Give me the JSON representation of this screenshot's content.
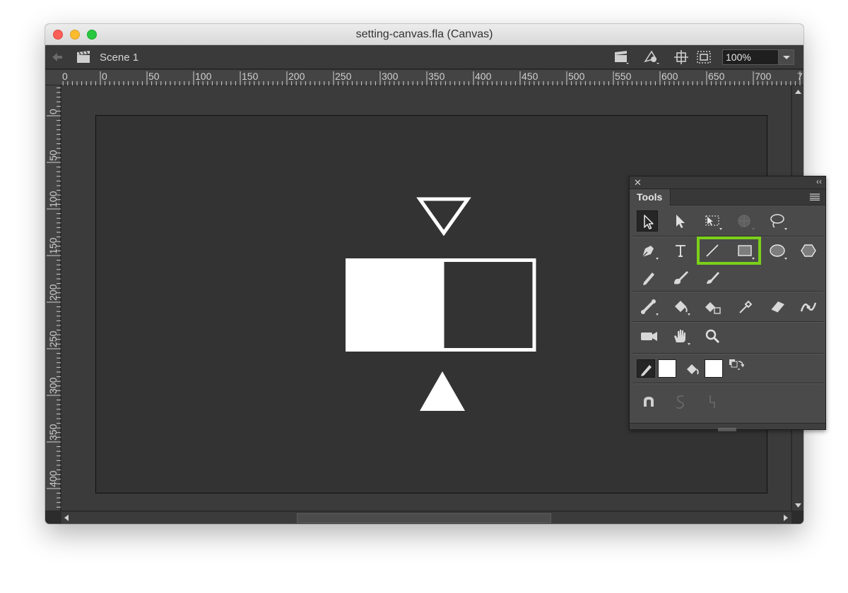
{
  "window": {
    "title": "setting-canvas.fla (Canvas)"
  },
  "appbar": {
    "scene_label": "Scene 1",
    "zoom_value": "100%",
    "icons": [
      "back-arrow-icon",
      "scene-clapper-icon",
      "edit-scene-icon",
      "edit-symbols-icon",
      "snap-center-icon",
      "clip-stage-icon"
    ]
  },
  "ruler": {
    "horizontal_labels": [
      "0",
      "0",
      "50",
      "100",
      "150",
      "200",
      "250",
      "300",
      "350",
      "400",
      "450",
      "500",
      "550",
      "600",
      "650",
      "700",
      "7"
    ],
    "vertical_labels": [
      "0",
      "50",
      "100",
      "150",
      "200",
      "250",
      "300",
      "350",
      "400"
    ]
  },
  "stage": {
    "background": "#333333",
    "shape_color": "#ffffff"
  },
  "tools_panel": {
    "tab_label": "Tools",
    "close_glyph": "✕",
    "collapse_glyph": "‹‹",
    "highlight_color": "#7bd01a",
    "tools": [
      "selection-tool",
      "subselection-tool",
      "free-transform-tool",
      "3d-rotation-tool",
      "lasso-tool",
      "pen-tool",
      "text-tool",
      "line-tool",
      "rectangle-tool",
      "oval-tool",
      "polystar-tool",
      "pencil-tool",
      "brush-tool",
      "paint-brush-tool",
      "bone-tool",
      "paint-bucket-tool",
      "ink-bottle-tool",
      "eyedropper-tool",
      "eraser-tool",
      "width-tool",
      "camera-tool",
      "hand-tool",
      "zoom-tool",
      "stroke-color",
      "fill-color",
      "swap-colors",
      "snap-to-objects",
      "smooth",
      "straighten"
    ],
    "stroke_color": "#ffffff",
    "fill_color": "#ffffff"
  }
}
